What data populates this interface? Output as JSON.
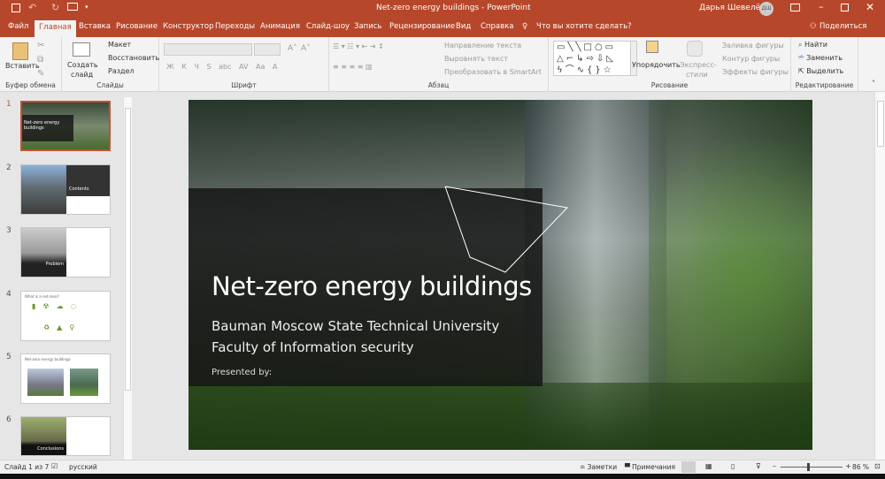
{
  "window": {
    "title": "Net-zero energy buildings  -  PowerPoint",
    "user": "Дарья Шевелёва",
    "avatar": "ДШ",
    "share": "Поделиться"
  },
  "tabs": [
    "Файл",
    "Главная",
    "Вставка",
    "Рисование",
    "Конструктор",
    "Переходы",
    "Анимация",
    "Слайд-шоу",
    "Запись",
    "Рецензирование",
    "Вид",
    "Справка"
  ],
  "tell_me": "Что вы хотите сделать?",
  "ribbon": {
    "clipboard": {
      "paste": "Вставить",
      "label": "Буфер обмена"
    },
    "slides": {
      "new_slide_1": "Создать",
      "new_slide_2": "слайд",
      "layout": "Макет",
      "reset": "Восстановить",
      "section": "Раздел",
      "label": "Слайды"
    },
    "font": {
      "label": "Шрифт",
      "buttons": [
        "Ж",
        "К",
        "Ч",
        "S",
        "abc",
        "AV",
        "Aa",
        "A"
      ]
    },
    "paragraph": {
      "label": "Абзац",
      "text_direction": "Направление текста",
      "align_text": "Выровнять текст",
      "smartart": "Преобразовать в SmartArt"
    },
    "drawing": {
      "label": "Рисование",
      "arrange": "Упорядочить",
      "quick_styles_1": "Экспресс-",
      "quick_styles_2": "стили",
      "fill": "Заливка фигуры",
      "outline": "Контур фигуры",
      "effects": "Эффекты фигуры"
    },
    "editing": {
      "label": "Редактирование",
      "find": "Найти",
      "replace": "Заменить",
      "select": "Выделить"
    }
  },
  "thumbnails": [
    {
      "n": "1",
      "title": "Net-zero energy buildings"
    },
    {
      "n": "2",
      "title": "Contents"
    },
    {
      "n": "3",
      "title": "Problem"
    },
    {
      "n": "4",
      "title": "What is a net-zero?"
    },
    {
      "n": "5",
      "title": "Net-zero energy buildings"
    },
    {
      "n": "6",
      "title": "Conclusions"
    }
  ],
  "slide": {
    "title": "Net-zero energy buildings",
    "line1": "Bauman Moscow State Technical University",
    "line2": "Faculty of Information security",
    "presented": "Presented by:"
  },
  "status": {
    "slide": "Слайд 1 из 7",
    "language": "русский",
    "notes": "Заметки",
    "comments": "Примечания",
    "zoom": "86 %",
    "zoom_percent": 86
  },
  "colors": {
    "accent": "#b7472a"
  }
}
